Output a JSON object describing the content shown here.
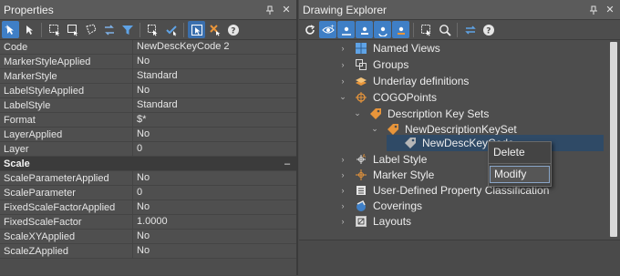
{
  "properties_panel": {
    "title": "Properties",
    "pin_icon": "pin-icon",
    "close_label": "✕",
    "rows_general": [
      {
        "name": "Code",
        "value": "NewDescKeyCode 2"
      },
      {
        "name": "MarkerStyleApplied",
        "value": "No"
      },
      {
        "name": "MarkerStyle",
        "value": "Standard"
      },
      {
        "name": "LabelStyleApplied",
        "value": "No"
      },
      {
        "name": "LabelStyle",
        "value": "Standard"
      },
      {
        "name": "Format",
        "value": "$*"
      },
      {
        "name": "LayerApplied",
        "value": "No"
      },
      {
        "name": "Layer",
        "value": "0"
      }
    ],
    "category": {
      "name": "Scale",
      "toggle": "–"
    },
    "rows_scale": [
      {
        "name": "ScaleParameterApplied",
        "value": "No"
      },
      {
        "name": "ScaleParameter",
        "value": "0"
      },
      {
        "name": "FixedScaleFactorApplied",
        "value": "No"
      },
      {
        "name": "FixedScaleFactor",
        "value": "1.0000"
      },
      {
        "name": "ScaleXYApplied",
        "value": "No"
      },
      {
        "name": "ScaleZApplied",
        "value": "No"
      }
    ]
  },
  "explorer_panel": {
    "title": "Drawing Explorer",
    "close_label": "✕",
    "tree": [
      {
        "label": "Named Views",
        "icon": "named-views-icon",
        "chev": "›"
      },
      {
        "label": "Groups",
        "icon": "groups-icon",
        "chev": "›"
      },
      {
        "label": "Underlay definitions",
        "icon": "underlay-icon",
        "chev": "›"
      },
      {
        "label": "COGOPoints",
        "icon": "cogo-points-icon",
        "chev": "⌄"
      },
      {
        "label": "Description Key Sets",
        "icon": "tag-icon",
        "chev": "⌄"
      },
      {
        "label": "NewDescriptionKeySet",
        "icon": "tag-icon",
        "chev": "⌄"
      },
      {
        "label": "NewDescKeyCode",
        "icon": "tag-small-icon",
        "chev": ""
      },
      {
        "label": "Label Style",
        "icon": "label-style-icon",
        "chev": "›"
      },
      {
        "label": "Marker Style",
        "icon": "marker-style-icon",
        "chev": "›"
      },
      {
        "label": "User-Defined Property Classification",
        "icon": "udp-icon",
        "chev": "›"
      },
      {
        "label": "Coverings",
        "icon": "coverings-icon",
        "chev": "›"
      },
      {
        "label": "Layouts",
        "icon": "layouts-icon",
        "chev": "›"
      }
    ],
    "context_menu": [
      "Delete",
      "Modify"
    ]
  },
  "colors": {
    "accent": "#3f7fc6",
    "orange": "#e8953a",
    "panel": "#4d4d4d"
  }
}
